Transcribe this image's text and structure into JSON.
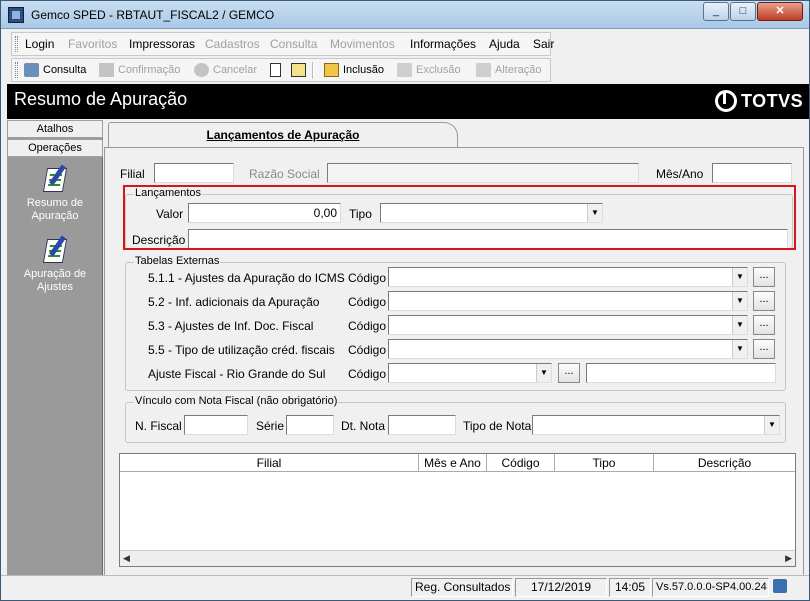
{
  "window": {
    "title": "Gemco SPED - RBTAUT_FISCAL2 / GEMCO",
    "min": "_",
    "max": "□",
    "close": "✕"
  },
  "menu": [
    {
      "label": "Login",
      "enabled": true
    },
    {
      "label": "Favoritos",
      "enabled": false
    },
    {
      "label": "Impressoras",
      "enabled": true
    },
    {
      "label": "Cadastros",
      "enabled": false
    },
    {
      "label": "Consulta",
      "enabled": false
    },
    {
      "label": "Movimentos",
      "enabled": false
    },
    {
      "label": "Informações",
      "enabled": true
    },
    {
      "label": "Ajuda",
      "enabled": true
    },
    {
      "label": "Sair",
      "enabled": true
    }
  ],
  "toolbar": {
    "consulta": "Consulta",
    "confirmacao": "Confirmação",
    "cancelar": "Cancelar",
    "inclusao": "Inclusão",
    "exclusao": "Exclusão",
    "alteracao": "Alteração"
  },
  "header": {
    "title": "Resumo de Apuração",
    "logo": "TOTVS"
  },
  "sidebar": {
    "tabs": [
      "Atalhos",
      "Operações"
    ],
    "items": [
      {
        "label1": "Resumo de",
        "label2": "Apuração",
        "icon": "document-pen-icon"
      },
      {
        "label1": "Apuração de",
        "label2": "Ajustes",
        "icon": "document-pen-icon"
      }
    ]
  },
  "tab": {
    "label": "Lançamentos de Apuração"
  },
  "form": {
    "filial_label": "Filial",
    "razao_label": "Razão Social",
    "mesano_label": "Mês/Ano",
    "lancamentos": {
      "legend": "Lançamentos",
      "valor_label": "Valor",
      "valor": "0,00",
      "tipo_label": "Tipo",
      "descricao_label": "Descrição"
    },
    "tabelas": {
      "legend": "Tabelas Externas",
      "codigo_label": "Código",
      "rows": [
        "5.1.1 - Ajustes da Apuração do ICMS",
        "5.2 - Inf. adicionais da Apuração",
        "5.3 - Ajustes de Inf. Doc. Fiscal",
        "5.5 - Tipo de utilização créd. fiscais",
        "Ajuste Fiscal - Rio Grande do Sul"
      ],
      "dots": "..."
    },
    "vinculo": {
      "legend": "Vínculo com Nota Fiscal (não obrigatório)",
      "nfiscal_label": "N. Fiscal",
      "serie_label": "Série",
      "dtnota_label": "Dt. Nota",
      "tiponota_label": "Tipo de Nota"
    }
  },
  "grid": {
    "columns": [
      "Filial",
      "Mês e Ano",
      "Código",
      "Tipo",
      "Descrição"
    ]
  },
  "status": {
    "reg": "Reg. Consultados :",
    "date": "17/12/2019",
    "time": "14:05",
    "version": "Vs.57.0.0.0-SP4.00.24"
  },
  "colors": {
    "highlight": "#d6151e",
    "header_bg": "#000000"
  }
}
